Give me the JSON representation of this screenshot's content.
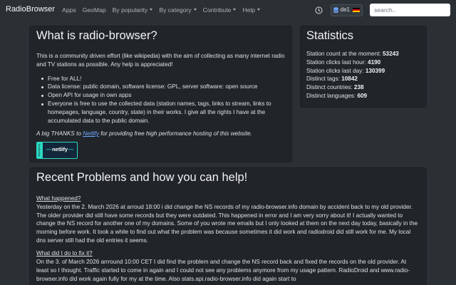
{
  "navbar": {
    "brand": "RadioBrowser",
    "links": [
      "Apps",
      "GeoMap"
    ],
    "dropdowns": [
      "By popularity",
      "By category",
      "Contribute",
      "Help"
    ],
    "server_label": "de1",
    "search_placeholder": "search.."
  },
  "intro": {
    "title": "What is radio-browser?",
    "paragraph": "This is a community driven effort (like wikipedia) with the aim of collecting as many internet radio and TV stations as possible. Any help is appreciated!",
    "bullets": [
      "Free for ALL!",
      "Data license: public domain, software license: GPL, server software: open source",
      "Open API for usage in own apps",
      "Everyone is free to use the collected data (station names, tags, links to stream, links to homepages, language, country, state) in their works. I give all the rights I have at the accumulated data to the public domain."
    ],
    "thanks_prefix": "A big THANKS to ",
    "thanks_link": "Netlify",
    "thanks_suffix": " for providing free high performance hosting of this website.",
    "badge_text": "netlify",
    "badge_side_text": "Deploys by"
  },
  "stats": {
    "title": "Statistics",
    "rows": [
      {
        "label": "Station count at the moment: ",
        "value": "53243"
      },
      {
        "label": "Station clicks last hour: ",
        "value": "4190"
      },
      {
        "label": "Station clicks last day: ",
        "value": "130399"
      },
      {
        "label": "Distinct tags: ",
        "value": "10842"
      },
      {
        "label": "Distinct countries: ",
        "value": "238"
      },
      {
        "label": "Distinct languages: ",
        "value": "609"
      }
    ]
  },
  "problems": {
    "title": "Recent Problems and how you can help!",
    "sections": [
      {
        "heading": "What happened?",
        "text": "Yesterday on the 2. March 2026 at arroud 18:00 i did change the NS records of my radio-browser.info domain by accident back to my old provider. The older provider did still have some records but they were outdated. This happened in error and I am very sorry about it! I actually wanted to change the NS record for another one of my domains. Some of you wrote me emails but I only looked at them on the next day today, basically in the morning before work. It took a while to find out what the problem was because sometimes it did work and radiodroid did still work for me. My local dns server still had the old entries it seems."
      },
      {
        "heading": "What did I do to fix it?",
        "text": "On the 3. of March 2026 arrround 10:00 CET I did find the problem and change the NS record back and fixed the records on the old provider. At least so I thought. Traffic started to come in again and I could not see any problems anymore from my usage pattern. RadioDroid and www.radio-browser.info did work again fully for my at the time. Also stats.api.radio-browser.info did again start to"
      }
    ]
  },
  "colors": {
    "background": "#2b3035",
    "card": "#212529",
    "link": "#6ea8fe",
    "netlify": "#2bd9c1"
  }
}
